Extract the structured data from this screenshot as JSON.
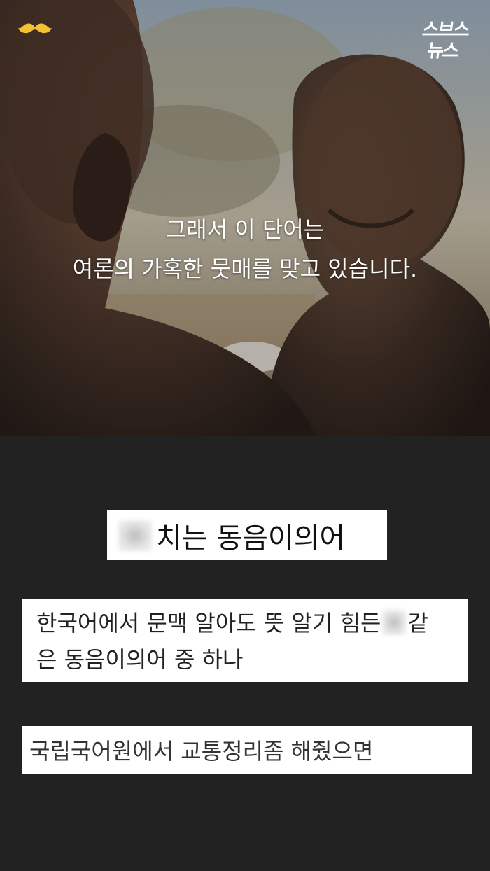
{
  "logo": {
    "line1": "스브스",
    "line2": "뉴스"
  },
  "caption": {
    "line1": "그래서 이 단어는",
    "line2": "여론의 가혹한 뭇매를 맞고 있습니다."
  },
  "card1": {
    "text": "치는 동음이의어"
  },
  "card2": {
    "line1_before": "한국어에서 문맥 알아도 뜻 알기 힘든",
    "line1_after": "같",
    "line2": "은 동음이의어 중 하나"
  },
  "card3": {
    "text": "국립국어원에서 교통정리좀 해줬으면"
  },
  "icons": {
    "mustache": "mustache-icon",
    "blur": "blurred-word"
  },
  "colors": {
    "mustache": "#f2c230",
    "background": "#222222",
    "card": "#ffffff"
  }
}
